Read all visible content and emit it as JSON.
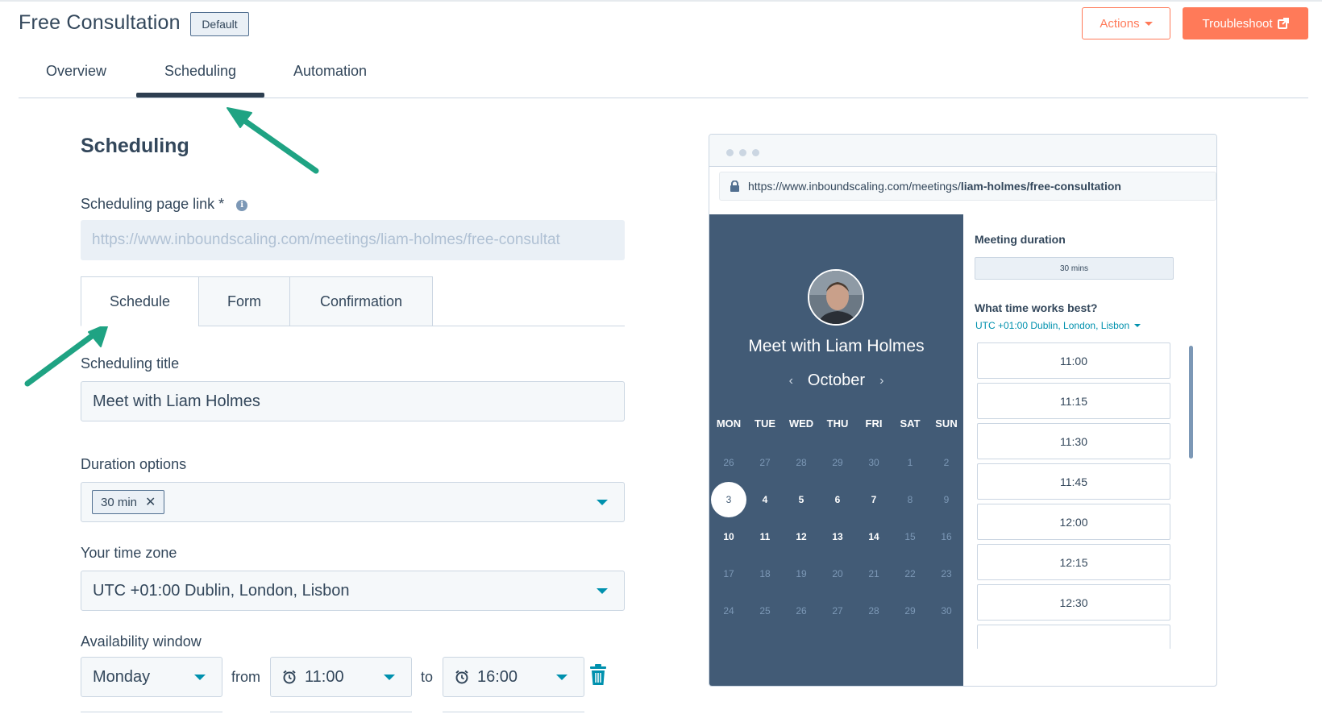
{
  "header": {
    "title": "Free Consultation",
    "badge": "Default",
    "actions_label": "Actions",
    "troubleshoot_label": "Troubleshoot"
  },
  "main_tabs": [
    {
      "label": "Overview"
    },
    {
      "label": "Scheduling",
      "active": true
    },
    {
      "label": "Automation"
    }
  ],
  "scheduling": {
    "section_title": "Scheduling",
    "page_link_label": "Scheduling page link *",
    "page_link_value": "https://www.inboundscaling.com/meetings/liam-holmes/free-consultat",
    "sub_tabs": [
      {
        "label": "Schedule",
        "active": true
      },
      {
        "label": "Form"
      },
      {
        "label": "Confirmation"
      }
    ],
    "title_label": "Scheduling title",
    "title_value": "Meet with Liam Holmes",
    "duration_label": "Duration options",
    "duration_chip": "30 min",
    "timezone_label": "Your time zone",
    "timezone_value": "UTC +01:00 Dublin, London, Lisbon",
    "availability_label": "Availability window",
    "availability": {
      "day": "Monday",
      "from_word": "from",
      "from_time": "11:00",
      "to_word": "to",
      "to_time": "16:00"
    }
  },
  "preview": {
    "url_prefix": "https://www.inboundscaling.com/meetings/",
    "url_path": "liam-holmes/free-consultation",
    "host_title": "Meet with Liam Holmes",
    "month": "October",
    "weekdays": [
      "MON",
      "TUE",
      "WED",
      "THU",
      "FRI",
      "SAT",
      "SUN"
    ],
    "weeks": [
      [
        {
          "d": "26",
          "s": "muted"
        },
        {
          "d": "27",
          "s": "muted"
        },
        {
          "d": "28",
          "s": "muted"
        },
        {
          "d": "29",
          "s": "muted"
        },
        {
          "d": "30",
          "s": "muted"
        },
        {
          "d": "1",
          "s": "muted"
        },
        {
          "d": "2",
          "s": "muted"
        }
      ],
      [
        {
          "d": "3",
          "s": "selected"
        },
        {
          "d": "4",
          "s": "avail"
        },
        {
          "d": "5",
          "s": "avail"
        },
        {
          "d": "6",
          "s": "avail"
        },
        {
          "d": "7",
          "s": "avail"
        },
        {
          "d": "8",
          "s": "muted"
        },
        {
          "d": "9",
          "s": "muted"
        }
      ],
      [
        {
          "d": "10",
          "s": "avail"
        },
        {
          "d": "11",
          "s": "avail"
        },
        {
          "d": "12",
          "s": "avail"
        },
        {
          "d": "13",
          "s": "avail"
        },
        {
          "d": "14",
          "s": "avail"
        },
        {
          "d": "15",
          "s": "muted"
        },
        {
          "d": "16",
          "s": "muted"
        }
      ],
      [
        {
          "d": "17",
          "s": "muted"
        },
        {
          "d": "18",
          "s": "muted"
        },
        {
          "d": "19",
          "s": "muted"
        },
        {
          "d": "20",
          "s": "muted"
        },
        {
          "d": "21",
          "s": "muted"
        },
        {
          "d": "22",
          "s": "muted"
        },
        {
          "d": "23",
          "s": "muted"
        }
      ],
      [
        {
          "d": "24",
          "s": "muted"
        },
        {
          "d": "25",
          "s": "muted"
        },
        {
          "d": "26",
          "s": "muted"
        },
        {
          "d": "27",
          "s": "muted"
        },
        {
          "d": "28",
          "s": "muted"
        },
        {
          "d": "29",
          "s": "muted"
        },
        {
          "d": "30",
          "s": "muted"
        }
      ]
    ],
    "meeting_duration_label": "Meeting duration",
    "meeting_duration_value": "30 mins",
    "time_question": "What time works best?",
    "timezone": "UTC +01:00 Dublin, London, Lisbon",
    "slots": [
      "11:00",
      "11:15",
      "11:30",
      "11:45",
      "12:00",
      "12:15",
      "12:30"
    ]
  },
  "colors": {
    "accent": "#ff7a59",
    "calendar_bg": "#425b76",
    "link": "#0091ae",
    "arrow": "#1fa383"
  }
}
